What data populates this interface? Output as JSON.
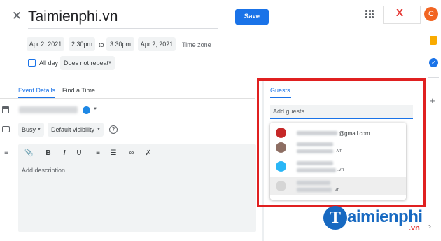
{
  "header": {
    "close_icon": "close-icon",
    "title": "Taimienphi.vn",
    "save_label": "Save",
    "apps_icon": "apps-grid-icon",
    "avatar_letter": "C"
  },
  "datetime": {
    "start_date": "Apr 2, 2021",
    "start_time": "2:30pm",
    "to": "to",
    "end_time": "3:30pm",
    "end_date": "Apr 2, 2021",
    "time_zone": "Time zone",
    "all_day_label": "All day",
    "all_day_checked": false,
    "repeat": "Does not repeat"
  },
  "tabs": [
    {
      "label": "Event Details",
      "active": true
    },
    {
      "label": "Find a Time",
      "active": false
    }
  ],
  "details": {
    "calendar_color": "#1e88e5",
    "status": "Busy",
    "visibility": "Default visibility",
    "help_glyph": "?",
    "description_placeholder": "Add description"
  },
  "toolbar": {
    "attach": "⊘",
    "bold": "B",
    "italic": "I",
    "underline": "U",
    "ordered_list": "≡",
    "bullet_list": "☰",
    "link": "∞",
    "clear_format": "✗"
  },
  "guests": {
    "title": "Guests",
    "placeholder": "Add guests",
    "suggestions": [
      {
        "suffix": "@gmail.com",
        "avatar_color": "#c62828"
      },
      {
        "suffix": ".vn",
        "avatar_color": "#8d6e63"
      },
      {
        "suffix": ".vn",
        "avatar_color": "#29b6f6"
      },
      {
        "suffix": ".vn",
        "avatar_color": "#d5d5d5"
      }
    ]
  },
  "branding": {
    "logo_letter": "X",
    "watermark_letter": "T",
    "watermark_text": "aimienphi",
    "watermark_suffix": ".vn"
  },
  "colors": {
    "accent": "#1a73e8",
    "highlight_frame": "#e02020"
  }
}
